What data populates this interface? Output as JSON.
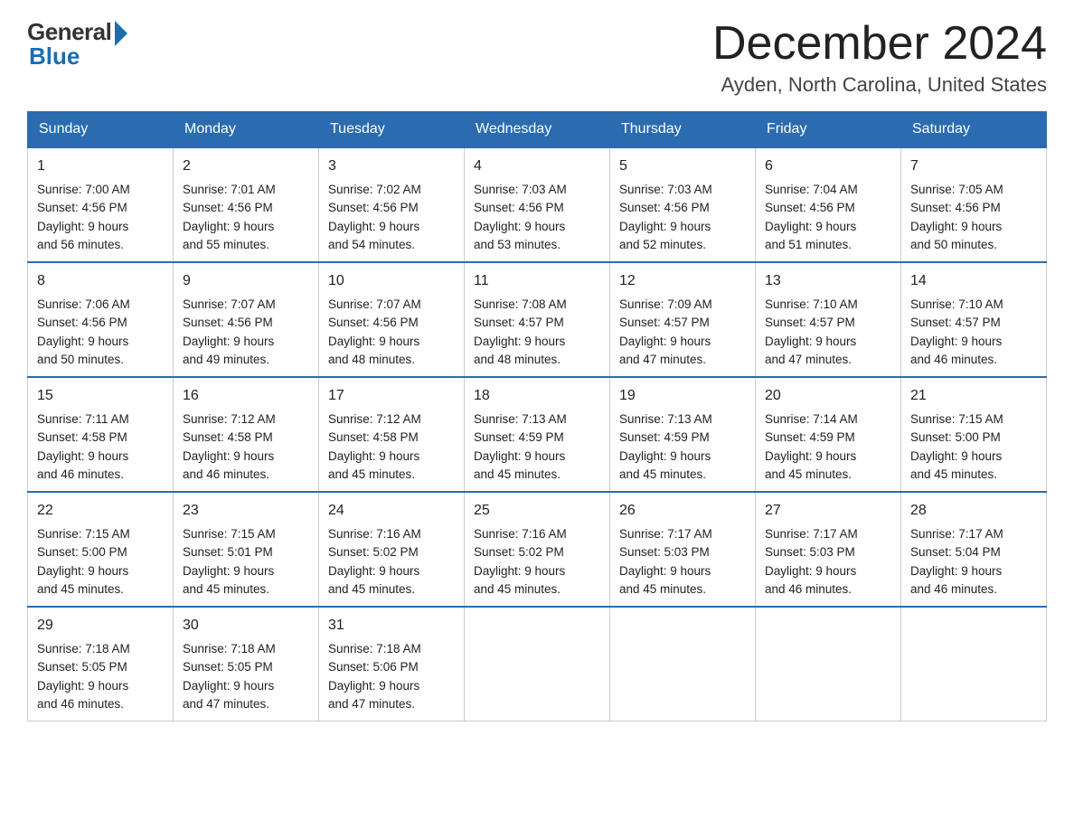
{
  "logo": {
    "general": "General",
    "blue": "Blue"
  },
  "header": {
    "month_year": "December 2024",
    "location": "Ayden, North Carolina, United States"
  },
  "weekdays": [
    "Sunday",
    "Monday",
    "Tuesday",
    "Wednesday",
    "Thursday",
    "Friday",
    "Saturday"
  ],
  "weeks": [
    [
      {
        "day": "1",
        "sunrise": "7:00 AM",
        "sunset": "4:56 PM",
        "daylight": "9 hours and 56 minutes."
      },
      {
        "day": "2",
        "sunrise": "7:01 AM",
        "sunset": "4:56 PM",
        "daylight": "9 hours and 55 minutes."
      },
      {
        "day": "3",
        "sunrise": "7:02 AM",
        "sunset": "4:56 PM",
        "daylight": "9 hours and 54 minutes."
      },
      {
        "day": "4",
        "sunrise": "7:03 AM",
        "sunset": "4:56 PM",
        "daylight": "9 hours and 53 minutes."
      },
      {
        "day": "5",
        "sunrise": "7:03 AM",
        "sunset": "4:56 PM",
        "daylight": "9 hours and 52 minutes."
      },
      {
        "day": "6",
        "sunrise": "7:04 AM",
        "sunset": "4:56 PM",
        "daylight": "9 hours and 51 minutes."
      },
      {
        "day": "7",
        "sunrise": "7:05 AM",
        "sunset": "4:56 PM",
        "daylight": "9 hours and 50 minutes."
      }
    ],
    [
      {
        "day": "8",
        "sunrise": "7:06 AM",
        "sunset": "4:56 PM",
        "daylight": "9 hours and 50 minutes."
      },
      {
        "day": "9",
        "sunrise": "7:07 AM",
        "sunset": "4:56 PM",
        "daylight": "9 hours and 49 minutes."
      },
      {
        "day": "10",
        "sunrise": "7:07 AM",
        "sunset": "4:56 PM",
        "daylight": "9 hours and 48 minutes."
      },
      {
        "day": "11",
        "sunrise": "7:08 AM",
        "sunset": "4:57 PM",
        "daylight": "9 hours and 48 minutes."
      },
      {
        "day": "12",
        "sunrise": "7:09 AM",
        "sunset": "4:57 PM",
        "daylight": "9 hours and 47 minutes."
      },
      {
        "day": "13",
        "sunrise": "7:10 AM",
        "sunset": "4:57 PM",
        "daylight": "9 hours and 47 minutes."
      },
      {
        "day": "14",
        "sunrise": "7:10 AM",
        "sunset": "4:57 PM",
        "daylight": "9 hours and 46 minutes."
      }
    ],
    [
      {
        "day": "15",
        "sunrise": "7:11 AM",
        "sunset": "4:58 PM",
        "daylight": "9 hours and 46 minutes."
      },
      {
        "day": "16",
        "sunrise": "7:12 AM",
        "sunset": "4:58 PM",
        "daylight": "9 hours and 46 minutes."
      },
      {
        "day": "17",
        "sunrise": "7:12 AM",
        "sunset": "4:58 PM",
        "daylight": "9 hours and 45 minutes."
      },
      {
        "day": "18",
        "sunrise": "7:13 AM",
        "sunset": "4:59 PM",
        "daylight": "9 hours and 45 minutes."
      },
      {
        "day": "19",
        "sunrise": "7:13 AM",
        "sunset": "4:59 PM",
        "daylight": "9 hours and 45 minutes."
      },
      {
        "day": "20",
        "sunrise": "7:14 AM",
        "sunset": "4:59 PM",
        "daylight": "9 hours and 45 minutes."
      },
      {
        "day": "21",
        "sunrise": "7:15 AM",
        "sunset": "5:00 PM",
        "daylight": "9 hours and 45 minutes."
      }
    ],
    [
      {
        "day": "22",
        "sunrise": "7:15 AM",
        "sunset": "5:00 PM",
        "daylight": "9 hours and 45 minutes."
      },
      {
        "day": "23",
        "sunrise": "7:15 AM",
        "sunset": "5:01 PM",
        "daylight": "9 hours and 45 minutes."
      },
      {
        "day": "24",
        "sunrise": "7:16 AM",
        "sunset": "5:02 PM",
        "daylight": "9 hours and 45 minutes."
      },
      {
        "day": "25",
        "sunrise": "7:16 AM",
        "sunset": "5:02 PM",
        "daylight": "9 hours and 45 minutes."
      },
      {
        "day": "26",
        "sunrise": "7:17 AM",
        "sunset": "5:03 PM",
        "daylight": "9 hours and 45 minutes."
      },
      {
        "day": "27",
        "sunrise": "7:17 AM",
        "sunset": "5:03 PM",
        "daylight": "9 hours and 46 minutes."
      },
      {
        "day": "28",
        "sunrise": "7:17 AM",
        "sunset": "5:04 PM",
        "daylight": "9 hours and 46 minutes."
      }
    ],
    [
      {
        "day": "29",
        "sunrise": "7:18 AM",
        "sunset": "5:05 PM",
        "daylight": "9 hours and 46 minutes."
      },
      {
        "day": "30",
        "sunrise": "7:18 AM",
        "sunset": "5:05 PM",
        "daylight": "9 hours and 47 minutes."
      },
      {
        "day": "31",
        "sunrise": "7:18 AM",
        "sunset": "5:06 PM",
        "daylight": "9 hours and 47 minutes."
      },
      null,
      null,
      null,
      null
    ]
  ],
  "labels": {
    "sunrise": "Sunrise:",
    "sunset": "Sunset:",
    "daylight": "Daylight:"
  }
}
